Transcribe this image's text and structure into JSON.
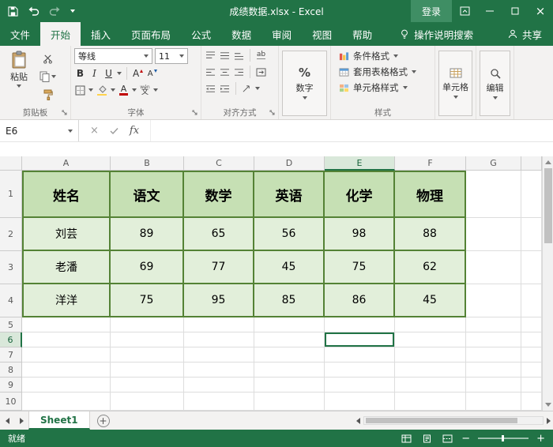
{
  "colors": {
    "excel_green": "#217346",
    "table_border_green": "#548235",
    "table_header_fill": "#c6e0b4",
    "table_cell_fill": "#e2efda"
  },
  "title_bar": {
    "title": "成绩数据.xlsx  -  Excel",
    "login_label": "登录"
  },
  "menu_bar": {
    "tabs": [
      {
        "label": "文件"
      },
      {
        "label": "开始"
      },
      {
        "label": "插入"
      },
      {
        "label": "页面布局"
      },
      {
        "label": "公式"
      },
      {
        "label": "数据"
      },
      {
        "label": "审阅"
      },
      {
        "label": "视图"
      },
      {
        "label": "帮助"
      }
    ],
    "active_tab": "开始",
    "search_label": "操作说明搜索",
    "share_label": "共享"
  },
  "ribbon": {
    "paste_label": "粘贴",
    "clipboard_group_label": "剪贴板",
    "font_name": "等线",
    "font_size": "11",
    "bold_label": "B",
    "italic_label": "I",
    "underline_label": "U",
    "pinyin_top": "wén",
    "pinyin_bottom": "文",
    "wrap_label": "ab",
    "font_group_label": "字体",
    "alignment_group_label": "对齐方式",
    "percent_symbol": "%",
    "number_label": "数字",
    "conditional_formatting_label": "条件格式",
    "format_as_table_label": "套用表格格式",
    "cell_styles_label": "单元格样式",
    "styles_group_label": "样式",
    "cells_label": "单元格",
    "editing_label": "编辑"
  },
  "formula_bar": {
    "name_box_value": "E6",
    "fx_label": "fx"
  },
  "grid": {
    "column_letters": [
      "A",
      "B",
      "C",
      "D",
      "E",
      "F",
      "G"
    ],
    "row_numbers": [
      "1",
      "2",
      "3",
      "4",
      "5",
      "6",
      "7",
      "8",
      "9",
      "10"
    ],
    "header_row": [
      "姓名",
      "语文",
      "数学",
      "英语",
      "化学",
      "物理"
    ],
    "data_rows": [
      [
        "刘芸",
        "89",
        "65",
        "56",
        "98",
        "88"
      ],
      [
        "老潘",
        "69",
        "77",
        "45",
        "75",
        "62"
      ],
      [
        "洋洋",
        "75",
        "95",
        "85",
        "86",
        "45"
      ]
    ],
    "active_cell": "E6"
  },
  "sheet_bar": {
    "sheet_tab_label": "Sheet1"
  },
  "status_bar": {
    "ready_label": "就绪"
  }
}
